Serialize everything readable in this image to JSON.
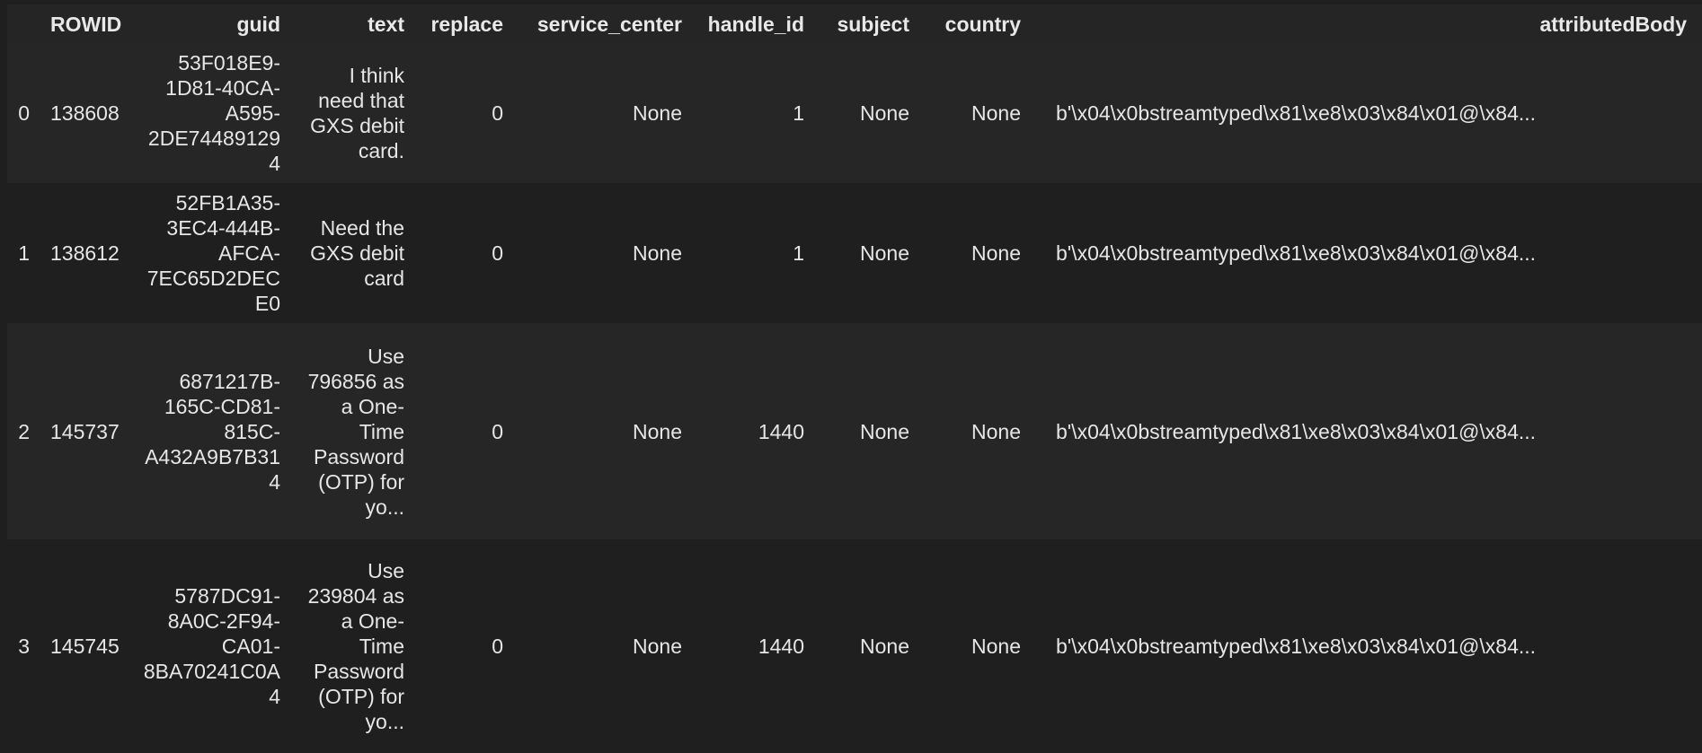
{
  "columns": [
    "",
    "ROWID",
    "guid",
    "text",
    "replace",
    "service_center",
    "handle_id",
    "subject",
    "country",
    "attributedBody"
  ],
  "rows": [
    {
      "index": "0",
      "ROWID": "138608",
      "guid": "53F018E9-1D81-40CA-A595-2DE744891294",
      "text": "I think need that GXS debit card.",
      "replace": "0",
      "service_center": "None",
      "handle_id": "1",
      "subject": "None",
      "country": "None",
      "attributedBody": "b'\\x04\\x0bstreamtyped\\x81\\xe8\\x03\\x84\\x01@\\x84..."
    },
    {
      "index": "1",
      "ROWID": "138612",
      "guid": "52FB1A35-3EC4-444B-AFCA-7EC65D2DECE0",
      "text": "Need the GXS debit card",
      "replace": "0",
      "service_center": "None",
      "handle_id": "1",
      "subject": "None",
      "country": "None",
      "attributedBody": "b'\\x04\\x0bstreamtyped\\x81\\xe8\\x03\\x84\\x01@\\x84..."
    },
    {
      "index": "2",
      "ROWID": "145737",
      "guid": "6871217B-165C-CD81-815C-A432A9B7B314",
      "text": "Use 796856 as a One-Time Password (OTP) for yo...",
      "replace": "0",
      "service_center": "None",
      "handle_id": "1440",
      "subject": "None",
      "country": "None",
      "attributedBody": "b'\\x04\\x0bstreamtyped\\x81\\xe8\\x03\\x84\\x01@\\x84..."
    },
    {
      "index": "3",
      "ROWID": "145745",
      "guid": "5787DC91-8A0C-2F94-CA01-8BA70241C0A4",
      "text": "Use 239804 as a One-Time Password (OTP) for yo...",
      "replace": "0",
      "service_center": "None",
      "handle_id": "1440",
      "subject": "None",
      "country": "None",
      "attributedBody": "b'\\x04\\x0bstreamtyped\\x81\\xe8\\x03\\x84\\x01@\\x84..."
    }
  ]
}
